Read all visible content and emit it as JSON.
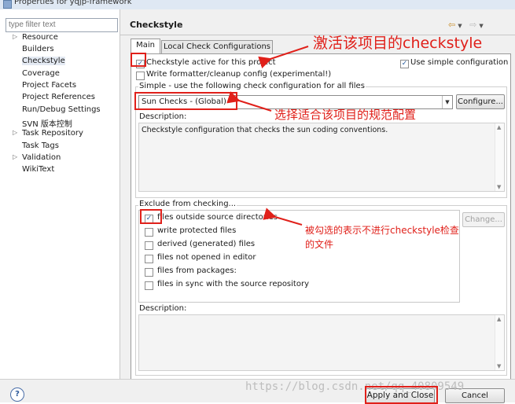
{
  "window": {
    "title": "Properties for yqjp-framework"
  },
  "filter": {
    "placeholder": "type filter text"
  },
  "tree": [
    {
      "label": "Resource",
      "expandable": true
    },
    {
      "label": "Builders",
      "expandable": false
    },
    {
      "label": "Checkstyle",
      "expandable": false,
      "selected": true
    },
    {
      "label": "Coverage",
      "expandable": false
    },
    {
      "label": "Project Facets",
      "expandable": false
    },
    {
      "label": "Project References",
      "expandable": false
    },
    {
      "label": "Run/Debug Settings",
      "expandable": false
    },
    {
      "label": "SVN 版本控制",
      "expandable": false
    },
    {
      "label": "Task Repository",
      "expandable": true
    },
    {
      "label": "Task Tags",
      "expandable": false
    },
    {
      "label": "Validation",
      "expandable": true
    },
    {
      "label": "WikiText",
      "expandable": false
    }
  ],
  "page": {
    "title": "Checkstyle"
  },
  "tabs": {
    "main": "Main",
    "local": "Local Check Configurations"
  },
  "options": {
    "active_label": "Checkstyle active for this project",
    "active_checked": true,
    "formatter_label": "Write formatter/cleanup config (experimental!)",
    "formatter_checked": false,
    "simple_label": "Use simple configuration",
    "simple_checked": true
  },
  "simple_group": {
    "title": "Simple - use the following check configuration for all files",
    "config_value": "Sun Checks  - (Global)",
    "configure_button": "Configure...",
    "description_label": "Description:",
    "description_text": "Checkstyle configuration that checks the sun coding conventions."
  },
  "exclude_group": {
    "title": "Exclude from checking...",
    "filters": [
      {
        "label": "files outside source directories",
        "checked": true
      },
      {
        "label": "write protected files",
        "checked": false
      },
      {
        "label": "derived (generated) files",
        "checked": false
      },
      {
        "label": "files not opened in editor",
        "checked": false
      },
      {
        "label": "files from packages:",
        "checked": false
      },
      {
        "label": "files in sync with the source repository",
        "checked": false
      }
    ],
    "change_button": "Change...",
    "description_label": "Description:"
  },
  "buttons": {
    "help": "?",
    "apply_close": "Apply and Close",
    "cancel": "Cancel"
  },
  "annotations": {
    "activate": "激活该项目的checkstyle",
    "choose": "选择适合该项目的规范配置",
    "exclude_line1": "被勾选的表示不进行checkstyle检查",
    "exclude_line2": "的文件"
  },
  "watermark": "https://blog.csdn.net/qq_40809549",
  "colors": {
    "annotation_red": "#e0201a",
    "selection": "#e4eaf3"
  }
}
